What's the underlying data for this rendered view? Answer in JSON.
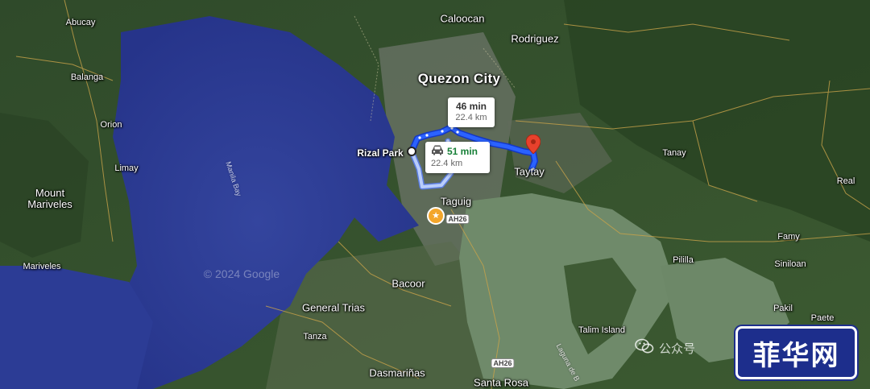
{
  "places": {
    "caloocan": "Caloocan",
    "rodriguez": "Rodriguez",
    "abucay": "Abucay",
    "balanga": "Balanga",
    "orion": "Orion",
    "limay": "Limay",
    "mount_mariveles": "Mount\nMariveles",
    "mariveles": "Mariveles",
    "manila_bay": "Manila Bay",
    "quezon_city": "Quezon City",
    "rizal_park": "Rizal Park",
    "taytay": "Taytay",
    "tanay": "Tanay",
    "real": "Real",
    "taguig": "Taguig",
    "famy": "Famy",
    "pililla": "Pililla",
    "siniloan": "Siniloan",
    "bacoor": "Bacoor",
    "general_trias": "General Trias",
    "tanza": "Tanza",
    "pakil": "Pakil",
    "paete": "Paete",
    "talim_island": "Talim Island",
    "dasmarinas": "Dasmariñas",
    "santa_rosa": "Santa Rosa",
    "laguna": "Laguna de B"
  },
  "routes": {
    "primary": {
      "time": "46 min",
      "distance": "22.4 km"
    },
    "alternate": {
      "time": "51 min",
      "distance": "22.4 km",
      "mode_icon": "car-icon"
    }
  },
  "road_shields": {
    "ah26_north": "AH26",
    "ah26_south": "AH26"
  },
  "watermark": "© 2024 Google",
  "wechat_label": "公众号",
  "logo_text": "菲华网",
  "colors": {
    "route_primary": "#1a53ff",
    "route_alt": "#aac4ff",
    "pin": "#e8412c",
    "water": "#2f3f9c",
    "lake": "#6f8a6a"
  }
}
